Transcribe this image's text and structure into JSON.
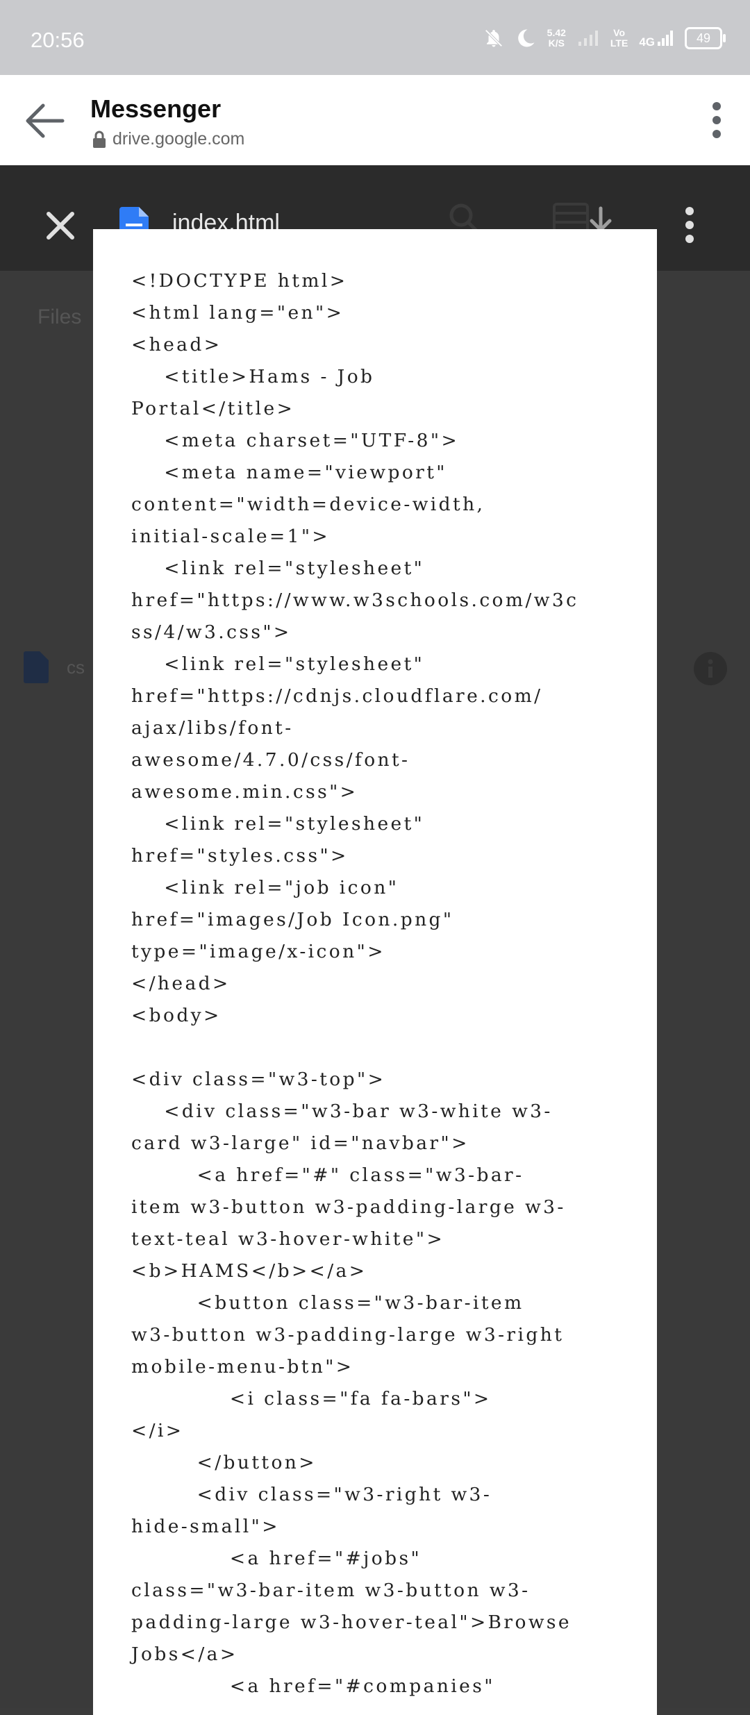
{
  "status_bar": {
    "time": "20:56",
    "net_speed_value": "5.42",
    "net_speed_unit": "K/S",
    "volte_top": "Vo",
    "volte_bottom": "LTE",
    "network": "4G",
    "battery": "49",
    "icons": [
      "mute-bell-icon",
      "moon-icon",
      "signal-icon",
      "signal-icon",
      "battery-icon"
    ]
  },
  "app_bar": {
    "title": "Messenger",
    "url": "drive.google.com",
    "icons": [
      "back-arrow-icon",
      "lock-icon",
      "more-vert-icon"
    ]
  },
  "viewer": {
    "file_name": "index.html",
    "files_label": "Files",
    "background_file_name": "cs",
    "icons": [
      "close-icon",
      "google-doc-icon",
      "search-icon",
      "list-icon",
      "download-icon",
      "more-vert-icon",
      "info-icon"
    ]
  },
  "code_lines": [
    "<!DOCTYPE html>",
    "<html lang=\"en\">",
    "<head>",
    "    <title>Hams - Job",
    "Portal</title>",
    "    <meta charset=\"UTF-8\">",
    "    <meta name=\"viewport\"",
    "content=\"width=device-width,",
    "initial-scale=1\">",
    "    <link rel=\"stylesheet\"",
    "href=\"https://www.w3schools.com/w3c",
    "ss/4/w3.css\">",
    "    <link rel=\"stylesheet\"",
    "href=\"https://cdnjs.cloudflare.com/",
    "ajax/libs/font-",
    "awesome/4.7.0/css/font-",
    "awesome.min.css\">",
    "    <link rel=\"stylesheet\"",
    "href=\"styles.css\">",
    "    <link rel=\"job icon\"",
    "href=\"images/Job Icon.png\"",
    "type=\"image/x-icon\">",
    "</head>",
    "<body>",
    "",
    "<div class=\"w3-top\">",
    "    <div class=\"w3-bar w3-white w3-",
    "card w3-large\" id=\"navbar\">",
    "        <a href=\"#\" class=\"w3-bar-",
    "item w3-button w3-padding-large w3-",
    "text-teal w3-hover-white\">",
    "<b>HAMS</b></a>",
    "        <button class=\"w3-bar-item",
    "w3-button w3-padding-large w3-right",
    "mobile-menu-btn\">",
    "            <i class=\"fa fa-bars\">",
    "</i>",
    "        </button>",
    "        <div class=\"w3-right w3-",
    "hide-small\">",
    "            <a href=\"#jobs\"",
    "class=\"w3-bar-item w3-button w3-",
    "padding-large w3-hover-teal\">Browse",
    "Jobs</a>",
    "            <a href=\"#companies\""
  ]
}
